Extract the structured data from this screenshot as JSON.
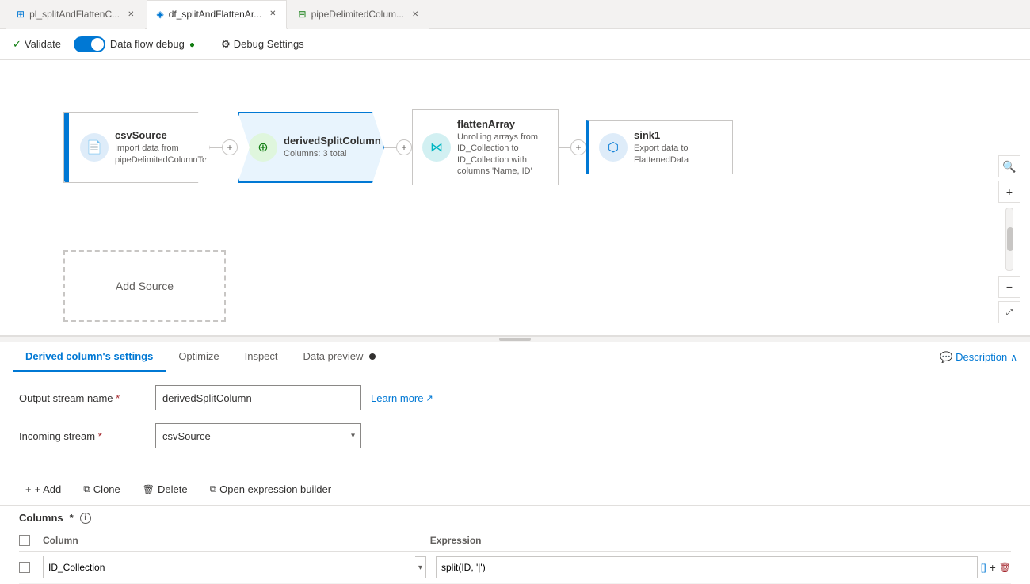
{
  "tabs": [
    {
      "id": "tab1",
      "label": "pl_splitAndFlattenC...",
      "icon": "grid",
      "active": false
    },
    {
      "id": "tab2",
      "label": "df_splitAndFlattenAr...",
      "icon": "dataflow",
      "active": true
    },
    {
      "id": "tab3",
      "label": "pipeDelimitedColum...",
      "icon": "table",
      "active": false
    }
  ],
  "toolbar": {
    "validate_label": "Validate",
    "debug_label": "Data flow debug",
    "debug_settings_label": "Debug Settings"
  },
  "pipeline": {
    "nodes": [
      {
        "id": "csvSource",
        "title": "csvSource",
        "desc": "Import data from pipeDelimitedColumnToRowSource",
        "icon_type": "csv",
        "active": false
      },
      {
        "id": "derivedSplitColumn",
        "title": "derivedSplitColumn",
        "desc": "Columns: 3 total",
        "icon_type": "derived",
        "active": true
      },
      {
        "id": "flattenArray",
        "title": "flattenArray",
        "desc": "Unrolling arrays from ID_Collection to ID_Collection with columns 'Name, ID'",
        "icon_type": "flatten",
        "active": false
      },
      {
        "id": "sink1",
        "title": "sink1",
        "desc": "Export data to FlattenedData",
        "icon_type": "sink",
        "active": false
      }
    ],
    "add_source_label": "Add Source"
  },
  "settings_panel": {
    "tabs": [
      {
        "id": "derived_settings",
        "label": "Derived column's settings",
        "active": true
      },
      {
        "id": "optimize",
        "label": "Optimize",
        "active": false
      },
      {
        "id": "inspect",
        "label": "Inspect",
        "active": false
      },
      {
        "id": "data_preview",
        "label": "Data preview",
        "active": false
      }
    ],
    "description_label": "Description",
    "output_stream": {
      "label": "Output stream name",
      "value": "derivedSplitColumn"
    },
    "learn_more_label": "Learn more",
    "incoming_stream": {
      "label": "Incoming stream",
      "value": "csvSource",
      "options": [
        "csvSource"
      ]
    },
    "columns": {
      "label": "Columns",
      "actions": {
        "add": "+ Add",
        "clone": "Clone",
        "delete": "Delete",
        "open_expr": "Open expression builder"
      },
      "headers": [
        "Column",
        "Expression"
      ],
      "rows": [
        {
          "column": "ID_Collection",
          "expression": "split(ID, '|')"
        }
      ]
    }
  }
}
